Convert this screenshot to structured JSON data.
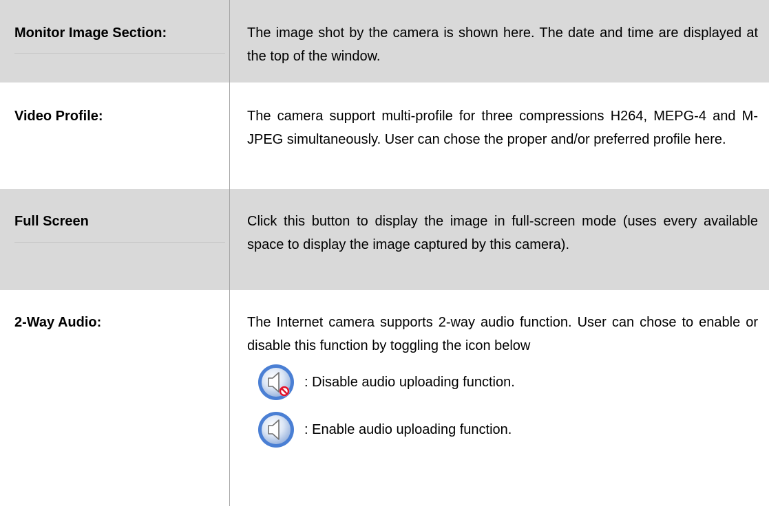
{
  "rows": [
    {
      "label": "Monitor Image Section:",
      "desc": "The image shot by the camera is shown here. The date and time are displayed at the top of the window."
    },
    {
      "label": "Video Profile:",
      "desc": "The camera support multi-profile for three compressions H264, MEPG-4 and M-JPEG simultaneously. User can chose the proper and/or preferred profile here."
    },
    {
      "label": "Full Screen",
      "desc": "Click this button to display the image in full-screen mode (uses every available space to display the image captured by this camera)."
    },
    {
      "label": "2-Way Audio:",
      "desc": "The Internet camera supports 2-way audio function. User can chose to enable or disable this function by toggling the icon below",
      "icons": [
        {
          "icon": "speaker-disabled-icon",
          "text": ": Disable audio uploading function."
        },
        {
          "icon": "speaker-icon",
          "text": ": Enable audio uploading function."
        }
      ]
    }
  ],
  "colors": {
    "shaded_row": "#d9d9d9",
    "divider": "#a6a6a6",
    "icon_blue": "#4a7fd4",
    "no_sign_red": "#e0102a"
  }
}
